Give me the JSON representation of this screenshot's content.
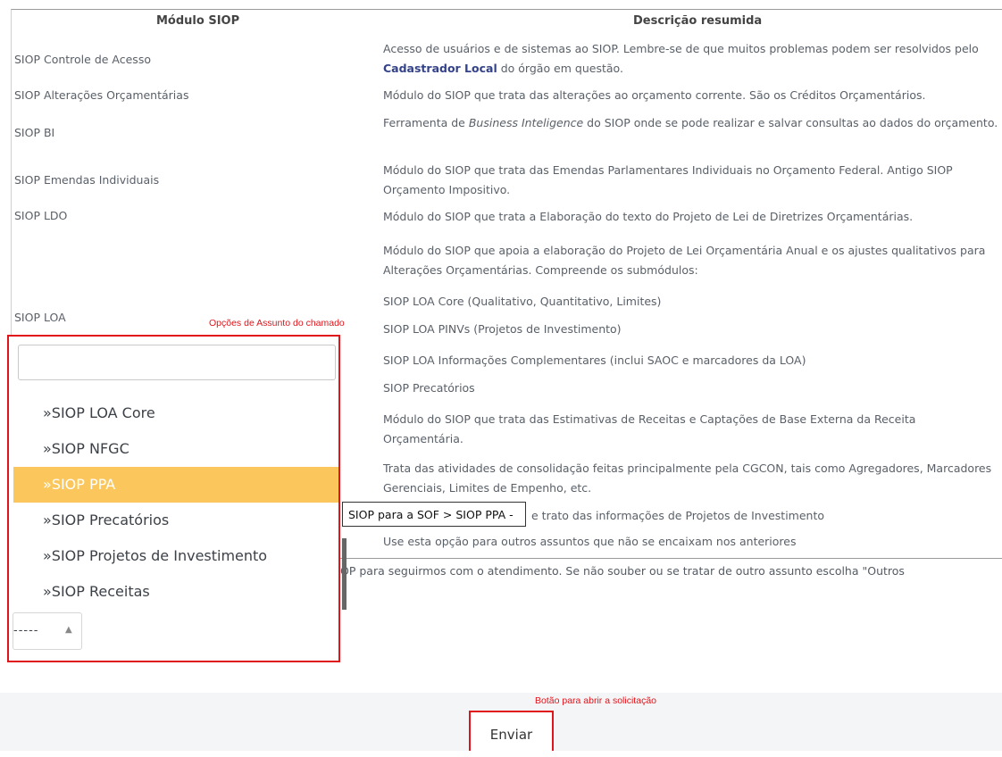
{
  "table": {
    "header_module": "Módulo SIOP",
    "header_description": "Descrição resumida",
    "modules": [
      "SIOP Controle de Acesso",
      "SIOP Alterações Orçamentárias",
      "SIOP BI",
      "SIOP Emendas Individuais",
      "SIOP LDO",
      "SIOP LOA"
    ],
    "desc": {
      "r1_pre": "Acesso de usuários e de sistemas ao SIOP. Lembre-se de que muitos problemas podem ser resolvidos pelo ",
      "r1_bold": "Cadastrador Local",
      "r1_post": " do órgão em questão.",
      "r2": "Módulo do SIOP que trata das alterações ao orçamento corrente. São os Créditos Orçamentários.",
      "r3_pre": "Ferramenta de ",
      "r3_italic": "Business Inteligence",
      "r3_post": " do SIOP onde se pode realizar e salvar consultas ao dados do orçamento.",
      "r4": "Módulo do SIOP que trata das Emendas Parlamentares Individuais no Orçamento Federal. Antigo SIOP Orçamento Impositivo.",
      "r5": "Módulo do SIOP que trata a Elaboração do texto do Projeto de Lei de Diretrizes Orçamentárias.",
      "r6": "Módulo do SIOP que apoia a elaboração do Projeto de Lei Orçamentária Anual e os ajustes qualitativos para Alterações Orçamentárias. Compreende os submódulos:",
      "r7": "SIOP LOA Core (Qualitativo, Quantitativo, Limites)",
      "r8": "SIOP LOA PINVs (Projetos de Investimento)",
      "r9": "SIOP LOA Informações Complementares (inclui SAOC e marcadores da LOA)",
      "r10": "SIOP Precatórios",
      "r11": "Módulo do SIOP que trata das Estimativas de Receitas e Captações de Base Externa da Receita Orçamentária.",
      "r12": "Trata das atividades de consolidação feitas principalmente pela CGCON, tais como Agregadores, Marcadores Gerenciais, Limites de Empenho, etc.",
      "r13": "e trato das informações de Projetos de Investimento",
      "r14": "Use esta opção para outros assuntos que não se encaixam nos anteriores"
    }
  },
  "annotation_subject": "Opções de Assunto do chamado",
  "annotation_button": "Botão para abrir a solicitação",
  "dropdown": {
    "search_value": "",
    "options": [
      "»SIOP LOA Core",
      "»SIOP NFGC",
      "»SIOP PPA",
      "»SIOP Precatórios",
      "»SIOP Projetos de Investimento",
      "»SIOP Receitas"
    ],
    "highlighted": "»SIOP PPA",
    "selected_value": "-----",
    "tooltip": "SIOP para a SOF > SIOP PPA -"
  },
  "help_text": "OP para seguirmos com o atendimento. Se não souber ou se tratar de outro assunto escolha \"Outros",
  "submit_label": "Enviar",
  "colors": {
    "annotation": "#e0151b",
    "highlight": "#fbc75c",
    "link": "#34428a"
  }
}
